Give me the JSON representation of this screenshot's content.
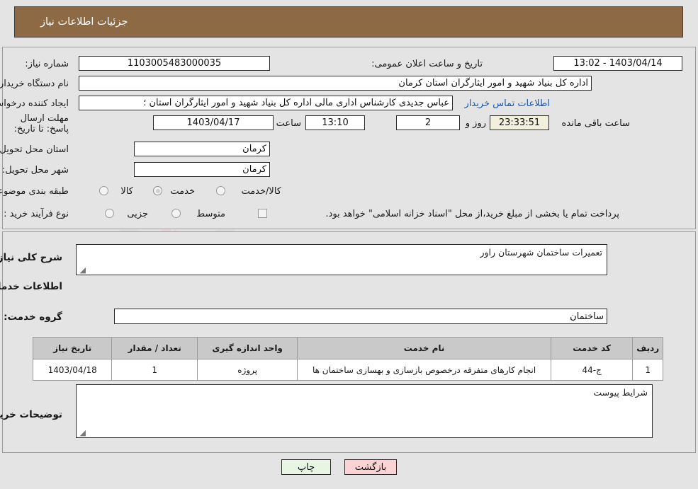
{
  "header": {
    "title": "جزئیات اطلاعات نیاز"
  },
  "watermark": {
    "text": "AriaTender.net"
  },
  "top_panel": {
    "need_number_label": "شماره نیاز:",
    "need_number_value": "1103005483000035",
    "announce_datetime_label": "تاریخ و ساعت اعلان عمومی:",
    "announce_datetime_value": "1403/04/14 - 13:02",
    "buyer_org_label": "نام دستگاه خریدار:",
    "buyer_org_value": "اداره کل بنیاد شهید و امور ایثارگران استان کرمان",
    "creator_label": "ایجاد کننده درخواست:",
    "creator_value": "عباس جدیدی کارشناس اداری مالی اداره کل بنیاد شهید و امور ایثارگران استان ؛",
    "buyer_contact_link": "اطلاعات تماس خریدار",
    "deadline_label": "مهلت ارسال پاسخ: تا تاریخ:",
    "deadline_date": "1403/04/17",
    "deadline_hour_label": "ساعت",
    "deadline_time": "13:10",
    "remaining_days": "2",
    "remaining_days_label": "روز و",
    "remaining_clock": "23:33:51",
    "remaining_suffix_label": "ساعت باقی مانده",
    "province_label": "استان محل تحویل:",
    "province_value": "کرمان",
    "city_label": "شهر محل تحویل:",
    "city_value": "کرمان",
    "category_label": "طبقه بندی موضوعی:",
    "category_options": [
      {
        "label": "کالا",
        "selected": false
      },
      {
        "label": "خدمت",
        "selected": true
      },
      {
        "label": "کالا/خدمت",
        "selected": false
      }
    ],
    "process_label": "نوع فرآیند خرید :",
    "process_options": [
      {
        "label": "جزیی",
        "selected": false
      },
      {
        "label": "متوسط",
        "selected": false
      }
    ],
    "treasury_checkbox_label": "پرداخت تمام یا بخشی از مبلغ خرید،از محل \"اسناد خزانه اسلامی\" خواهد بود.",
    "treasury_checked": false
  },
  "mid_panel": {
    "general_desc_label": "شرح کلی نیاز:",
    "general_desc_value": "تعمیرات ساختمان شهرستان راور",
    "services_info_heading": "اطلاعات خدمات مورد نیاز",
    "service_group_label": "گروه خدمت:",
    "service_group_value": "ساختمان",
    "table": {
      "columns": [
        "ردیف",
        "کد خدمت",
        "نام خدمت",
        "واحد اندازه گیری",
        "تعداد / مقدار",
        "تاریخ نیاز"
      ],
      "rows": [
        {
          "row": "1",
          "service_code": "ج-44",
          "service_name": "انجام کارهای متفرقه درخصوص بازسازی و بهسازی ساختمان ها",
          "unit": "پروژه",
          "quantity": "1",
          "need_date": "1403/04/18"
        }
      ]
    },
    "buyer_notes_label": "توضیحات خریدار:",
    "buyer_notes_value": "شرایط پیوست"
  },
  "footer": {
    "print_label": "چاپ",
    "back_label": "بازگشت"
  },
  "colors": {
    "header_bg": "#8d6a43",
    "page_bg": "#e4e4e4",
    "link": "#1558b0",
    "back_btn": "#fad4d4",
    "print_btn": "#e7f5e2",
    "table_header_bg": "#c9c9c9"
  }
}
